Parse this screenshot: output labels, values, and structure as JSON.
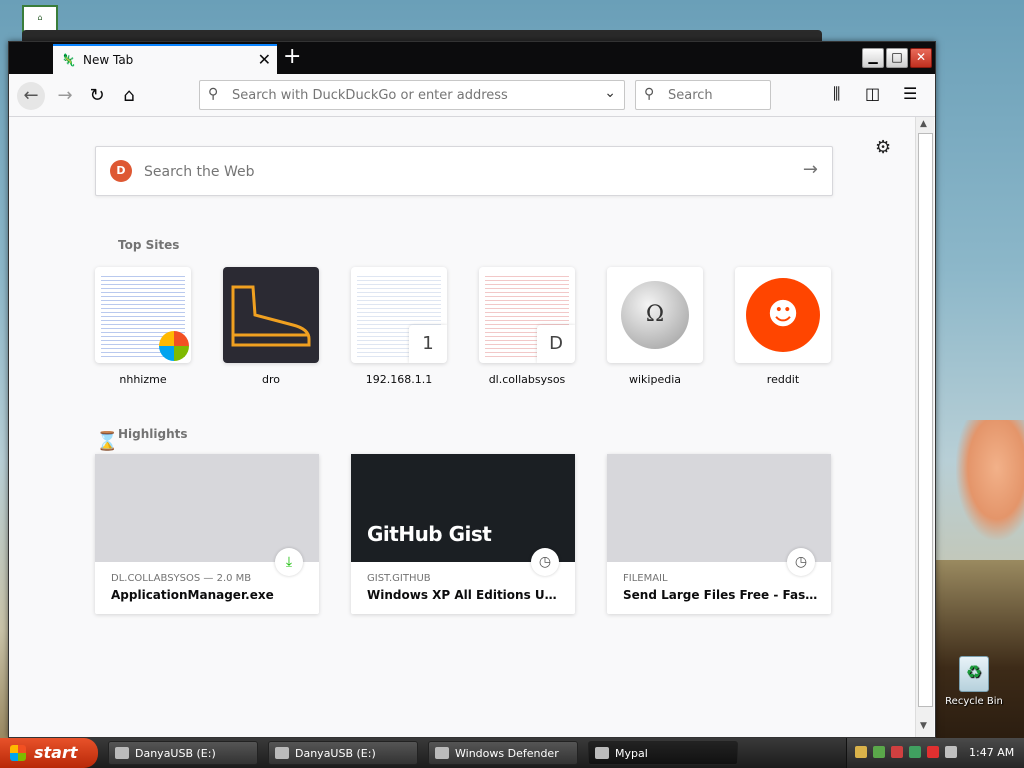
{
  "browser": {
    "tab": {
      "title": "New Tab"
    },
    "urlbar": {
      "placeholder": "Search with DuckDuckGo or enter address"
    },
    "searchbar": {
      "placeholder": "Search"
    }
  },
  "newtab": {
    "web_search_placeholder": "Search the Web",
    "top_sites_title": "Top Sites",
    "top_sites": [
      {
        "label": "nhhizme"
      },
      {
        "label": "dro"
      },
      {
        "label": "192.168.1.1",
        "badge": "1"
      },
      {
        "label": "dl.collabsysos",
        "badge": "D"
      },
      {
        "label": "wikipedia"
      },
      {
        "label": "reddit"
      }
    ],
    "highlights_title": "Highlights",
    "highlights": [
      {
        "source": "DL.COLLABSYSOS — 2.0 MB",
        "title": "ApplicationManager.exe",
        "icon": "download-icon"
      },
      {
        "source": "GIST.GITHUB",
        "title": "Windows XP All Editions Univer…",
        "image_text": "GitHub Gist",
        "icon": "clock-icon"
      },
      {
        "source": "FILEMAIL",
        "title": "Send Large Files Free - Fast Se…",
        "icon": "clock-icon"
      }
    ]
  },
  "desktop": {
    "recycle_bin_label": "Recycle Bin"
  },
  "taskbar": {
    "start_label": "start",
    "buttons": [
      {
        "label": "DanyaUSB (E:)"
      },
      {
        "label": "DanyaUSB (E:)"
      },
      {
        "label": "Windows Defender"
      },
      {
        "label": "Mypal"
      }
    ],
    "clock": "1:47 AM"
  },
  "colors": {
    "accent": "#0a84ff",
    "duckduckgo": "#de5833",
    "reddit": "#ff4500",
    "start_button": "#d0431c"
  }
}
